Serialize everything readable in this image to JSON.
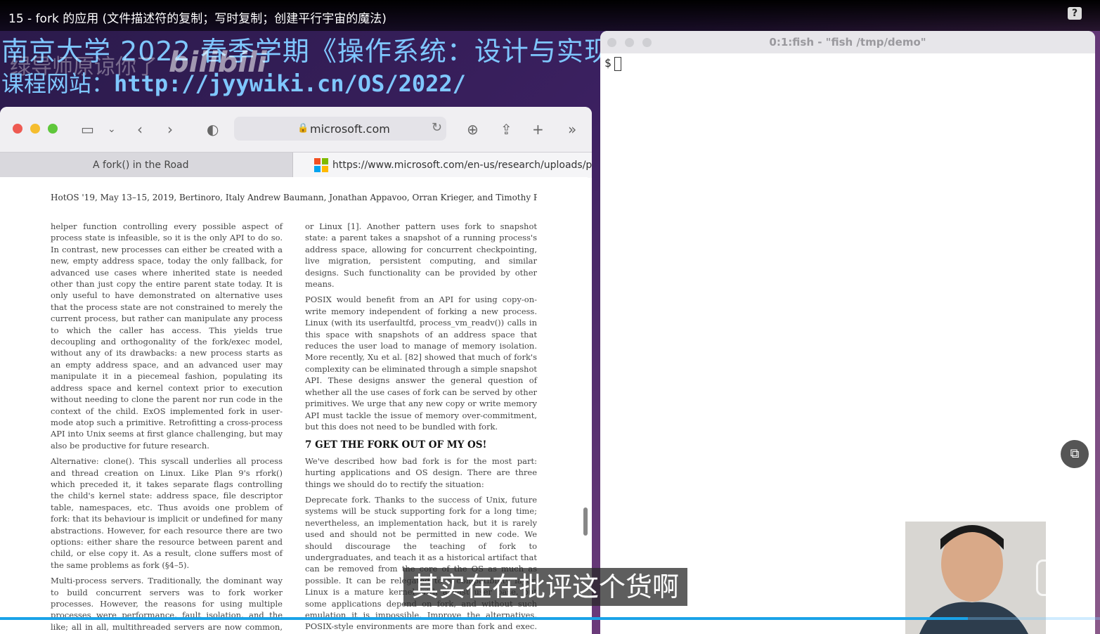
{
  "video": {
    "title": "15 - fork 的应用 (文件描述符的复制；写时复制；创建平行宇宙的魔法)",
    "help": "?",
    "subtitle": "其实在在批评这个货啊",
    "progress": 0.88
  },
  "slide": {
    "course_title": "南京大学 2022 春季学期《操作系统：设计与实现》",
    "url_label": "课程网站：",
    "url": "http://jyywiki.cn/OS/2022/",
    "watermark": "绿导师原谅你了",
    "logo": "bilibili"
  },
  "browser": {
    "url": "microsoft.com",
    "tabs": [
      {
        "label": "A fork() in the Road",
        "active": false
      },
      {
        "label": "https://www.microsoft.com/en-us/research/uploads/pro...",
        "active": true
      }
    ],
    "paper": {
      "header": "HotOS '19, May 13–15, 2019, Bertinoro, Italy    Andrew Baumann, Jonathan Appavoo, Orran Krieger, and Timothy Roscoe",
      "left_paragraphs": [
        "helper function controlling every possible aspect of process state is infeasible, so it is the only API to do so. In contrast, new processes can either be created with a new, empty address space, today the only fallback, for advanced use cases where inherited state is needed other than just copy the entire parent state today. It is only useful to have demonstrated on alternative uses that the process state are not constrained to merely the current process, but rather can manipulate any process to which the caller has access. This yields true decoupling and orthogonality of the fork/exec model, without any of its drawbacks: a new process starts as an empty address space, and an advanced user may manipulate it in a piecemeal fashion, populating its address space and kernel context prior to execution without needing to clone the parent nor run code in the context of the child. ExOS implemented fork in user-mode atop such a primitive. Retrofitting a cross-process API into Unix seems at first glance challenging, but may also be productive for future research.",
        "Alternative: clone(). This syscall underlies all process and thread creation on Linux. Like Plan 9's rfork() which preceded it, it takes separate flags controlling the child's kernel state: address space, file descriptor table, namespaces, etc. Thus avoids one problem of fork: that its behaviour is implicit or undefined for many abstractions. However, for each resource there are two options: either share the resource between parent and child, or else copy it. As a result, clone suffers most of the same problems as fork (§4–5).",
        "Multi-process servers. Traditionally, the dominant way to build concurrent servers was to fork worker processes. However, the reasons for using multiple processes were performance, fault isolation, and the like; all in all, multithreaded servers are now common, and forking is used mainly for isolation."
      ],
      "right_paragraphs": [
        "or Linux [1]. Another pattern uses fork to snapshot state: a parent takes a snapshot of a running process's address space, allowing for concurrent checkpointing, live migration, persistent computing, and similar designs. Such functionality can be provided by other means.",
        "POSIX would benefit from an API for using copy-on-write memory independent of forking a new process. Linux (with its userfaultfd, process_vm_readv()) calls in this space with snapshots of an address space that reduces the user load to manage of memory isolation. More recently, Xu et al. [82] showed that much of fork's complexity can be eliminated through a simple snapshot API. These designs answer the general question of whether all the use cases of fork can be served by other primitives. We urge that any new copy or write memory API must tackle the issue of memory over-commitment, but this does not need to be bundled with fork.",
        "GET THE FORK OUT OF MY OS!",
        "We've described how bad fork is for the most part: hurting applications and OS design. There are three things we should do to rectify the situation:",
        "Deprecate fork. Thanks to the success of Unix, future systems will be stuck supporting fork for a long time; nevertheless, an implementation hack, but it is rarely used and should not be permitted in new code. We should discourage the teaching of fork to undergraduates, and teach it as a historical artifact that can be removed from the core of the OS as much as possible. It can be relegated to a compatibility layer. Linux is a mature kernel with a vast user base, but some applications depend on fork, and without such emulation it is impossible. Improve the alternatives. POSIX-style environments are more than fork and exec. Windows is built on other abstractions layered on top. Thankfully, this is more to do."
      ],
      "section_heading": "7    GET THE FORK OUT OF MY OS!"
    }
  },
  "terminal": {
    "title": "0:1:fish - \"fish /tmp/demo\"",
    "prompt": "$"
  }
}
